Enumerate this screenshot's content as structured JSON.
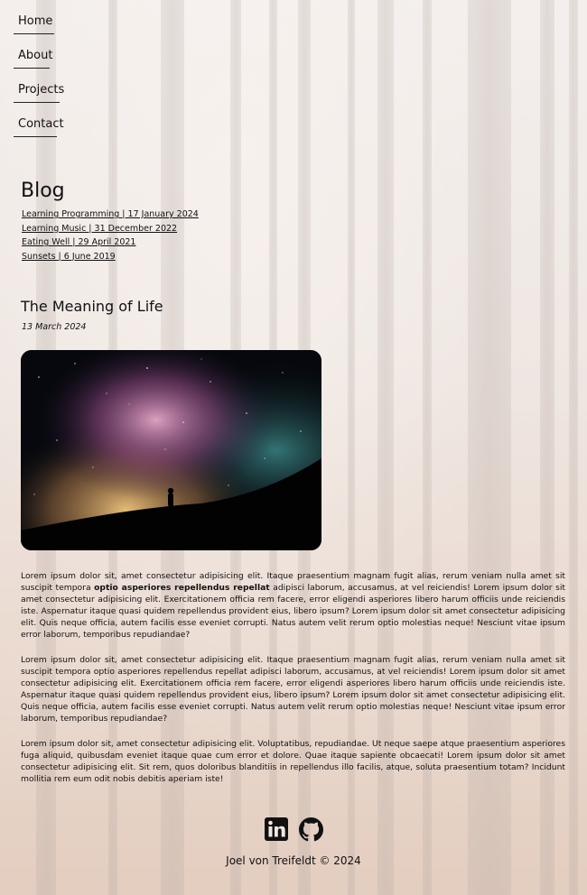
{
  "nav": {
    "items": [
      {
        "label": "Home"
      },
      {
        "label": "About"
      },
      {
        "label": "Projects"
      },
      {
        "label": "Contact"
      }
    ]
  },
  "blog": {
    "heading": "Blog",
    "links": [
      {
        "label": "Learning Programming | 17 January 2024"
      },
      {
        "label": "Learning Music | 31 December 2022"
      },
      {
        "label": "Eating Well | 29 April 2021"
      },
      {
        "label": "Sunsets | 6 June 2019"
      }
    ]
  },
  "post": {
    "title": "The Meaning of Life",
    "date": "13 March 2024",
    "paragraph1_a": "Lorem ipsum dolor sit, amet consectetur adipisicing elit. Itaque praesentium magnam fugit alias, rerum veniam nulla amet sit suscipit tempora ",
    "paragraph1_bold": "optio asperiores repellendus repellat",
    "paragraph1_b": " adipisci laborum, accusamus, at vel reiciendis! Lorem ipsum dolor sit amet consectetur adipisicing elit. Exercitationem officia rem facere, error eligendi asperiores libero harum officiis unde reiciendis iste. Aspernatur itaque quasi quidem repellendus provident eius, libero ipsum? Lorem ipsum dolor sit amet consectetur adipisicing elit. Quis neque officia, autem facilis esse eveniet corrupti. Natus autem velit rerum optio molestias neque! Nesciunt vitae ipsum error laborum, temporibus repudiandae?",
    "paragraph2": "Lorem ipsum dolor sit, amet consectetur adipisicing elit. Itaque praesentium magnam fugit alias, rerum veniam nulla amet sit suscipit tempora optio asperiores repellendus repellat adipisci laborum, accusamus, at vel reiciendis! Lorem ipsum dolor sit amet consectetur adipisicing elit. Exercitationem officia rem facere, error eligendi asperiores libero harum officiis unde reiciendis iste. Aspernatur itaque quasi quidem repellendus provident eius, libero ipsum? Lorem ipsum dolor sit amet consectetur adipisicing elit. Quis neque officia, autem facilis esse eveniet corrupti. Natus autem velit rerum optio molestias neque! Nesciunt vitae ipsum error laborum, temporibus repudiandae?",
    "paragraph3": "Lorem ipsum dolor sit, amet consectetur adipisicing elit. Voluptatibus, repudiandae. Ut neque saepe atque praesentium asperiores fuga aliquid, quibusdam eveniet itaque quae cum error et dolore. Quae itaque sapiente obcaecati! Lorem ipsum dolor sit amet consectetur adipisicing elit. Sit rem, quos doloribus blanditiis in repellendus illo facilis, atque, soluta praesentium totam? Incidunt mollitia rem eum odit nobis debitis aperiam iste!"
  },
  "footer": {
    "icons": [
      "linkedin-icon",
      "github-icon"
    ],
    "copyright": "Joel von Treifeldt © 2024"
  },
  "colors": {
    "text": "#111111",
    "background_light": "#ece5e2",
    "background_warm": "#d3b19c"
  }
}
